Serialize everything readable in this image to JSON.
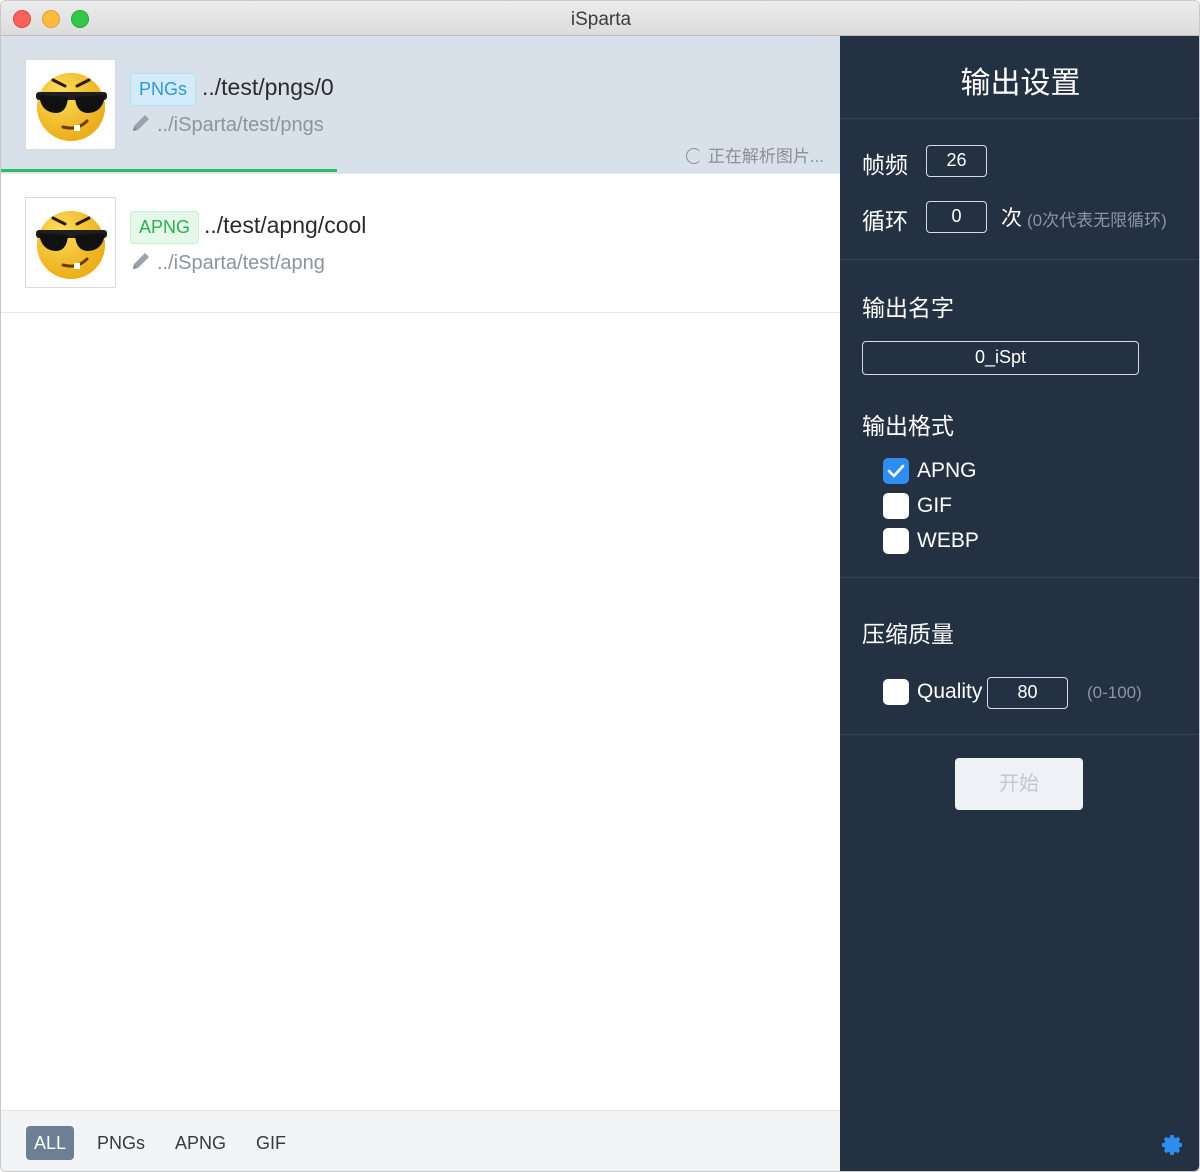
{
  "window": {
    "title": "iSparta"
  },
  "files": [
    {
      "type_badge": "PNGs",
      "path": "../test/pngs/0",
      "output_path": "../iSparta/test/pngs",
      "status": "正在解析图片...",
      "progress": 0.4
    },
    {
      "type_badge": "APNG",
      "path": "../test/apng/cool",
      "output_path": "../iSparta/test/apng"
    }
  ],
  "filters": [
    "ALL",
    "PNGs",
    "APNG",
    "GIF"
  ],
  "settings": {
    "title": "输出设置",
    "framerate_label": "帧频",
    "framerate": "26",
    "loop_label": "循环",
    "loop": "0",
    "loop_unit": "次",
    "loop_hint": "(0次代表无限循环)",
    "output_name_label": "输出名字",
    "output_name": "0_iSpt",
    "output_format_label": "输出格式",
    "formats": [
      {
        "label": "APNG",
        "checked": true
      },
      {
        "label": "GIF",
        "checked": false
      },
      {
        "label": "WEBP",
        "checked": false
      }
    ],
    "compress_label": "压缩质量",
    "quality_label": "Quality",
    "quality_checked": false,
    "quality": "80",
    "quality_hint": "(0-100)",
    "start_label": "开始"
  },
  "colors": {
    "panel_bg": "#243142",
    "accent_blue": "#2d8ef0",
    "progress_green": "#2bc06a",
    "selected_row": "#d8e0e9"
  }
}
